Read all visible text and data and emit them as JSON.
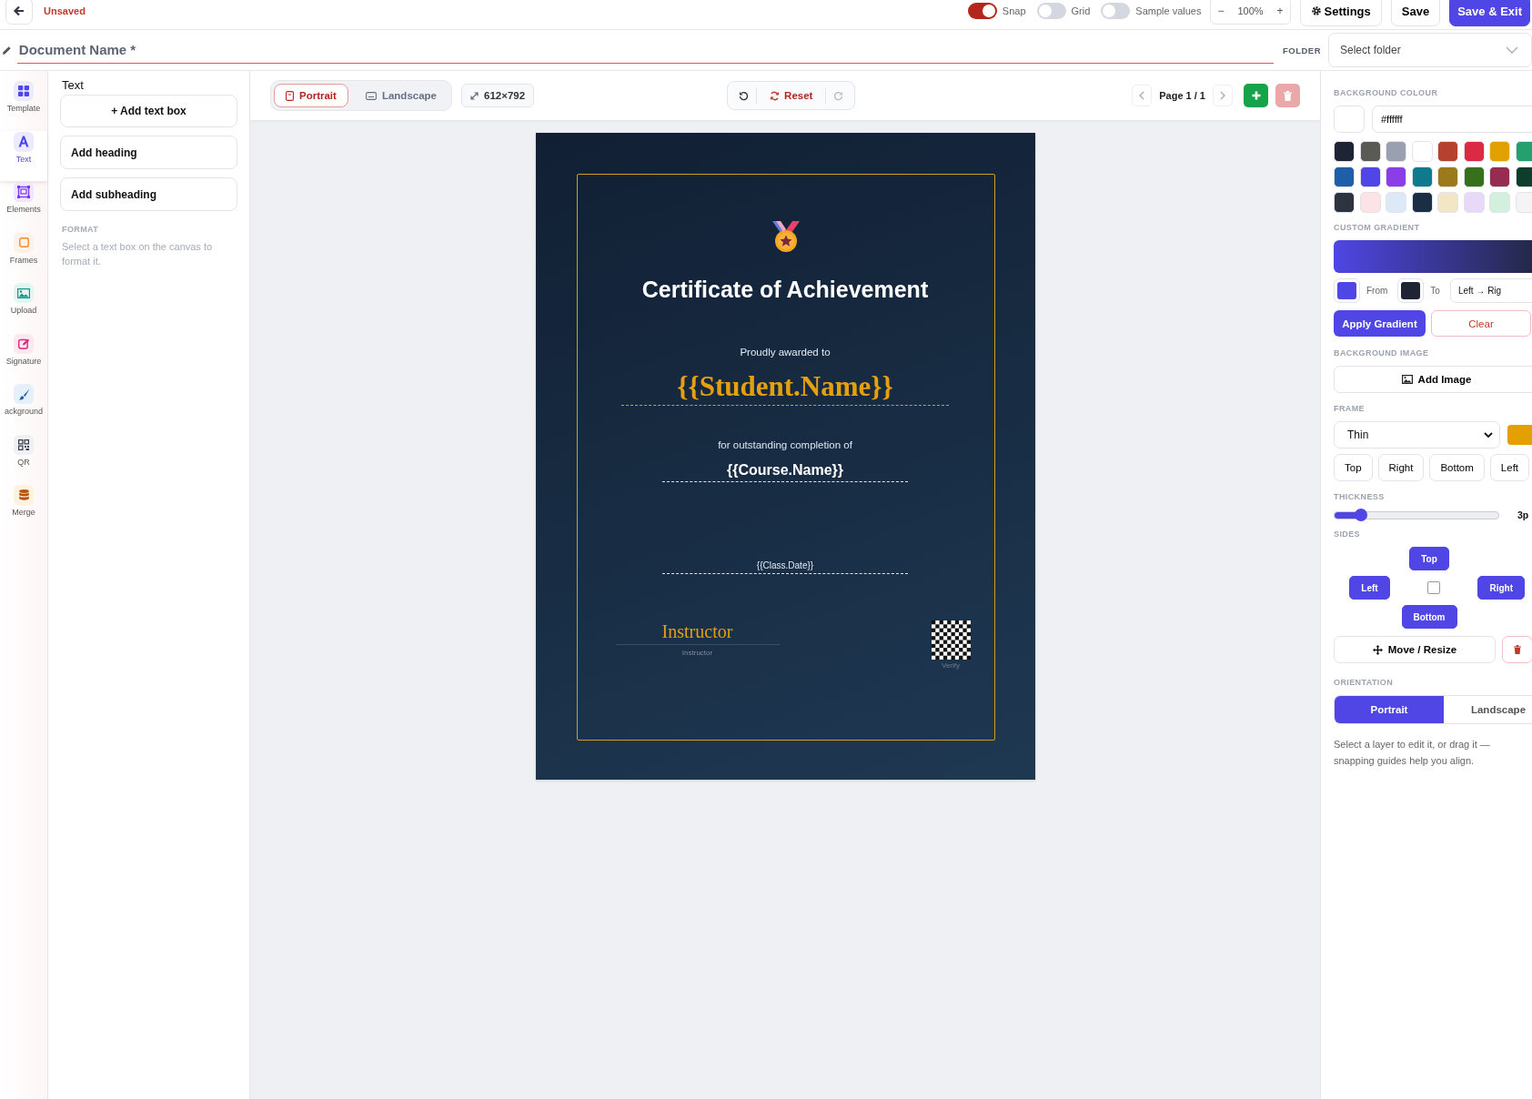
{
  "top_bar": {
    "status": "Unsaved",
    "toggles": [
      {
        "label": "Snap",
        "on": true
      },
      {
        "label": "Grid",
        "on": false
      },
      {
        "label": "Sample values",
        "on": false
      }
    ],
    "zoom": {
      "minus": "−",
      "value": "100%",
      "plus": "+"
    },
    "buttons": [
      {
        "label": "Settings",
        "kind": "settings"
      },
      {
        "label": "Save",
        "kind": "outline"
      },
      {
        "label": "Save & Exit",
        "kind": "primary"
      }
    ]
  },
  "document": {
    "name": "Document Name *",
    "folder_label": "FOLDER",
    "folder_placeholder": "Select folder"
  },
  "rail": [
    {
      "label": "Template",
      "kind": "template",
      "selected": false
    },
    {
      "label": "Text",
      "kind": "text",
      "selected": true
    },
    {
      "label": "Elements",
      "kind": "elements",
      "selected": false
    },
    {
      "label": "Frames",
      "kind": "frames",
      "selected": false
    },
    {
      "label": "Upload",
      "kind": "upload",
      "selected": false
    },
    {
      "label": "Signature",
      "kind": "signature",
      "selected": false
    },
    {
      "label": "ackground",
      "kind": "background",
      "selected": false
    },
    {
      "label": "QR",
      "kind": "qr",
      "selected": false
    },
    {
      "label": "Merge",
      "kind": "merge",
      "selected": false
    }
  ],
  "text_panel": {
    "title": "Text",
    "buttons": [
      {
        "label": "+ Add text box",
        "kind": "center"
      },
      {
        "label": "Add heading",
        "kind": "left"
      },
      {
        "label": "Add subheading",
        "kind": "left"
      }
    ],
    "format_heading": "FORMAT",
    "format_hint": "Select a text box on the canvas to format it."
  },
  "canvas_toolbar": {
    "orientation": [
      {
        "label": "Portrait",
        "kind": "portrait",
        "selected": true
      },
      {
        "label": "Landscape",
        "kind": "landscape",
        "selected": false
      }
    ],
    "size": "612×792",
    "reset": "Reset",
    "page": "Page 1 / 1"
  },
  "certificate": {
    "title": "Certificate of Achievement",
    "awarded_label": "Proudly awarded to",
    "student": "{{Student.Name}}",
    "completion_label": "for outstanding completion of",
    "course": "{{Course.Name}}",
    "date": "{{Class.Date}}",
    "signature": "Instructor",
    "signature_caption": "Instructor",
    "qr_caption": "Verify"
  },
  "right_panel": {
    "background_heading": "BACKGROUND COLOUR",
    "hex_value": "#ffffff",
    "swatches": [
      {
        "color": "#1e2433"
      },
      {
        "color": "#5a5a55"
      },
      {
        "color": "#9aa0b0"
      },
      {
        "color": "#ffffff"
      },
      {
        "color": "#b5412e"
      },
      {
        "color": "#dc2a45"
      },
      {
        "color": "#e2a100"
      },
      {
        "color": "#23a06e"
      },
      {
        "color": "#1e5fa8"
      },
      {
        "color": "#4f46e5"
      },
      {
        "color": "#8b3ee8"
      },
      {
        "color": "#0f7a8c"
      },
      {
        "color": "#9a7a1a"
      },
      {
        "color": "#37701c"
      },
      {
        "color": "#962c50"
      },
      {
        "color": "#0e3d2c"
      },
      {
        "color": "#2e3340"
      },
      {
        "color": "#fbe3e6"
      },
      {
        "color": "#dde9f8"
      },
      {
        "color": "#1a2e44"
      },
      {
        "color": "#f3e6c4"
      },
      {
        "color": "#e7d9f7"
      },
      {
        "color": "#d3f0de"
      },
      {
        "color": "#f4f4f4"
      }
    ],
    "gradient_heading": "CUSTOM GRADIENT",
    "from_label": "From",
    "to_label": "To",
    "direction": "Left → Rig",
    "apply_button": "Apply Gradient",
    "clear_button": "Clear",
    "image_heading": "BACKGROUND IMAGE",
    "add_image_button": "Add Image",
    "frame_heading": "FRAME",
    "frame_style": "Thin",
    "frame_sides": [
      {
        "label": "Top"
      },
      {
        "label": "Right"
      },
      {
        "label": "Bottom"
      },
      {
        "label": "Left"
      }
    ],
    "thickness_heading": "THICKNESS",
    "thickness": {
      "level": 0.16,
      "reading": "3p"
    },
    "sides_heading": "SIDES",
    "sides": {
      "top": {
        "label": "Top",
        "selected": true
      },
      "left": {
        "label": "Left",
        "selected": true
      },
      "center_checked": false,
      "right": {
        "label": "Right",
        "selected": true
      },
      "bottom": {
        "label": "Bottom",
        "selected": true
      }
    },
    "move_button": "Move / Resize",
    "orientation_heading": "ORIENTATION",
    "orientation": [
      {
        "label": "Portrait",
        "selected": true
      },
      {
        "label": "Landscape",
        "selected": false
      }
    ],
    "hint": "Select a layer to edit it, or drag it — snapping guides help you align."
  }
}
